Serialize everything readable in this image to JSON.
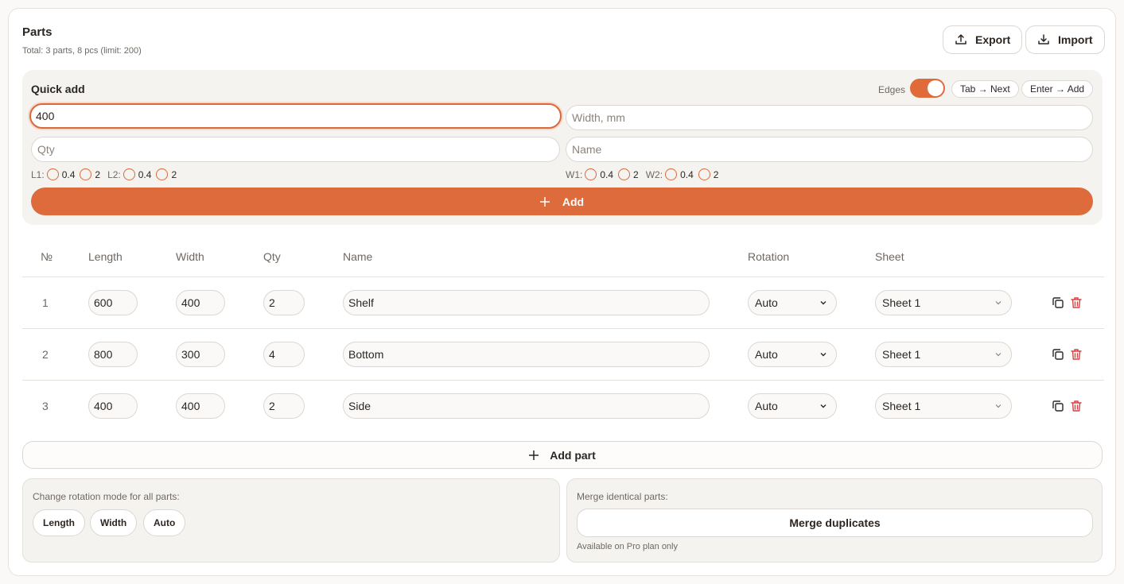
{
  "header": {
    "title": "Parts",
    "subtitle": "Total: 3 parts, 8 pcs (limit: 200)",
    "export_label": "Export",
    "import_label": "Import"
  },
  "quick_add": {
    "title": "Quick add",
    "edges_label": "Edges",
    "edges_on": true,
    "tab_hint": "Tab → Next",
    "enter_hint": "Enter → Add",
    "length_value": "400",
    "width_placeholder": "Width, mm",
    "qty_placeholder": "Qty",
    "name_placeholder": "Name",
    "edges_left": [
      {
        "label": "L1:",
        "opt_a": "0.4",
        "opt_b": "2"
      },
      {
        "label": "L2:",
        "opt_a": "0.4",
        "opt_b": "2"
      }
    ],
    "edges_right": [
      {
        "label": "W1:",
        "opt_a": "0.4",
        "opt_b": "2"
      },
      {
        "label": "W2:",
        "opt_a": "0.4",
        "opt_b": "2"
      }
    ],
    "add_label": "Add"
  },
  "table": {
    "columns": [
      "№",
      "Length",
      "Width",
      "Qty",
      "Name",
      "Rotation",
      "Sheet"
    ],
    "rows": [
      {
        "num": "1",
        "length": "600",
        "width": "400",
        "qty": "2",
        "name": "Shelf",
        "rotation": "Auto",
        "sheet": "Sheet 1"
      },
      {
        "num": "2",
        "length": "800",
        "width": "300",
        "qty": "4",
        "name": "Bottom",
        "rotation": "Auto",
        "sheet": "Sheet 1"
      },
      {
        "num": "3",
        "length": "400",
        "width": "400",
        "qty": "2",
        "name": "Side",
        "rotation": "Auto",
        "sheet": "Sheet 1"
      }
    ]
  },
  "add_part_label": "Add part",
  "rotation_panel": {
    "label": "Change rotation mode for all parts:",
    "buttons": [
      "Length",
      "Width",
      "Auto"
    ]
  },
  "merge_panel": {
    "label": "Merge identical parts:",
    "button": "Merge duplicates",
    "note": "Available on Pro plan only"
  },
  "colors": {
    "accent": "#dd6b3b",
    "delete": "#d94040"
  }
}
